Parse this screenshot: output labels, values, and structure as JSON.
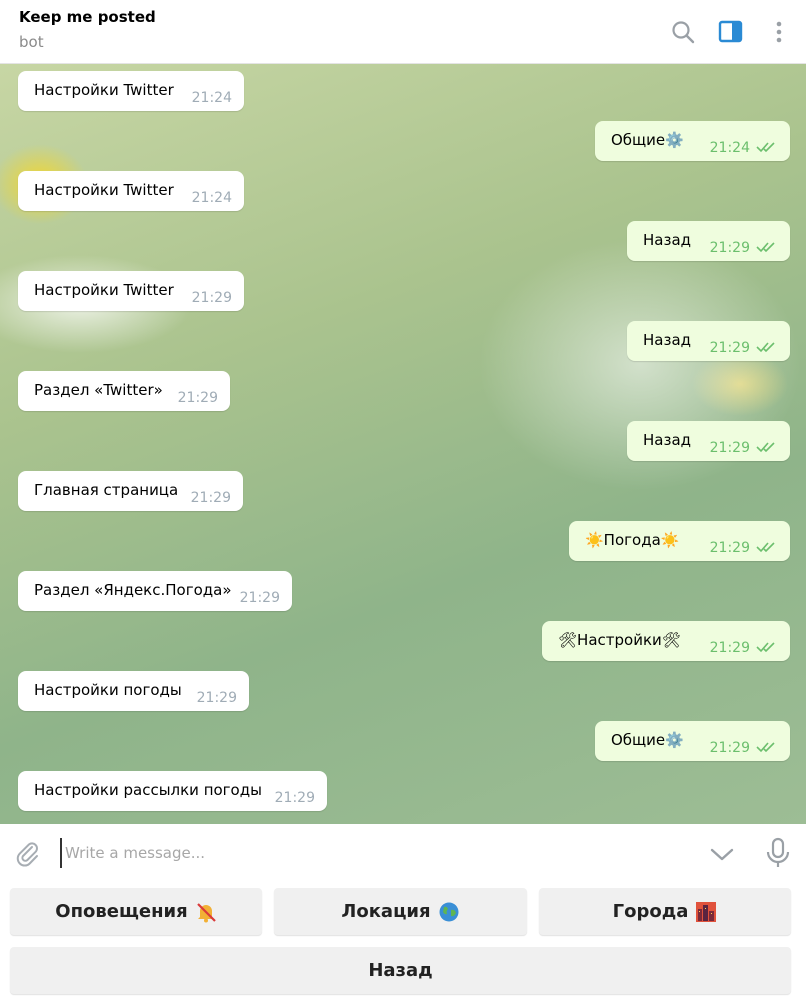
{
  "header": {
    "title": "Keep me posted",
    "subtitle": "bot",
    "icons": [
      "search-icon",
      "sidebar-toggle-icon",
      "more-vertical-icon"
    ],
    "accent_color": "#2a8ad4"
  },
  "messages": [
    {
      "dir": "in",
      "text": "Настройки Twitter",
      "time": "21:24"
    },
    {
      "dir": "out",
      "text": "Общие⚙️",
      "time": "21:24"
    },
    {
      "dir": "in",
      "text": "Настройки Twitter",
      "time": "21:24"
    },
    {
      "dir": "out",
      "text": "Назад",
      "time": "21:29"
    },
    {
      "dir": "in",
      "text": "Настройки Twitter",
      "time": "21:29"
    },
    {
      "dir": "out",
      "text": "Назад",
      "time": "21:29"
    },
    {
      "dir": "in",
      "text": "Раздел «Twitter»",
      "time": "21:29"
    },
    {
      "dir": "out",
      "text": "Назад",
      "time": "21:29"
    },
    {
      "dir": "in",
      "text": "Главная страница",
      "time": "21:29"
    },
    {
      "dir": "out",
      "text": "☀️Погода☀️",
      "time": "21:29"
    },
    {
      "dir": "in",
      "text": "Раздел «Яндекс.Погода»",
      "time": "21:29"
    },
    {
      "dir": "out",
      "text": "🛠Настройки🛠",
      "time": "21:29"
    },
    {
      "dir": "in",
      "text": "Настройки погоды",
      "time": "21:29"
    },
    {
      "dir": "out",
      "text": "Общие⚙️",
      "time": "21:29"
    },
    {
      "dir": "in",
      "text": "Настройки рассылки погоды",
      "time": "21:29"
    }
  ],
  "composer": {
    "placeholder": "Write a message...",
    "value": ""
  },
  "keyboard": {
    "row1": [
      {
        "label": "Оповещения",
        "emoji": "bell-off-icon"
      },
      {
        "label": "Локация",
        "emoji": "globe-icon"
      },
      {
        "label": "Города",
        "emoji": "city-icon"
      }
    ],
    "row2": [
      {
        "label": "Назад"
      }
    ]
  },
  "colors": {
    "incoming_bubble": "#ffffff",
    "outgoing_bubble": "#effdde",
    "outgoing_time": "#6cbf6d",
    "incoming_time": "#a0acb6"
  }
}
